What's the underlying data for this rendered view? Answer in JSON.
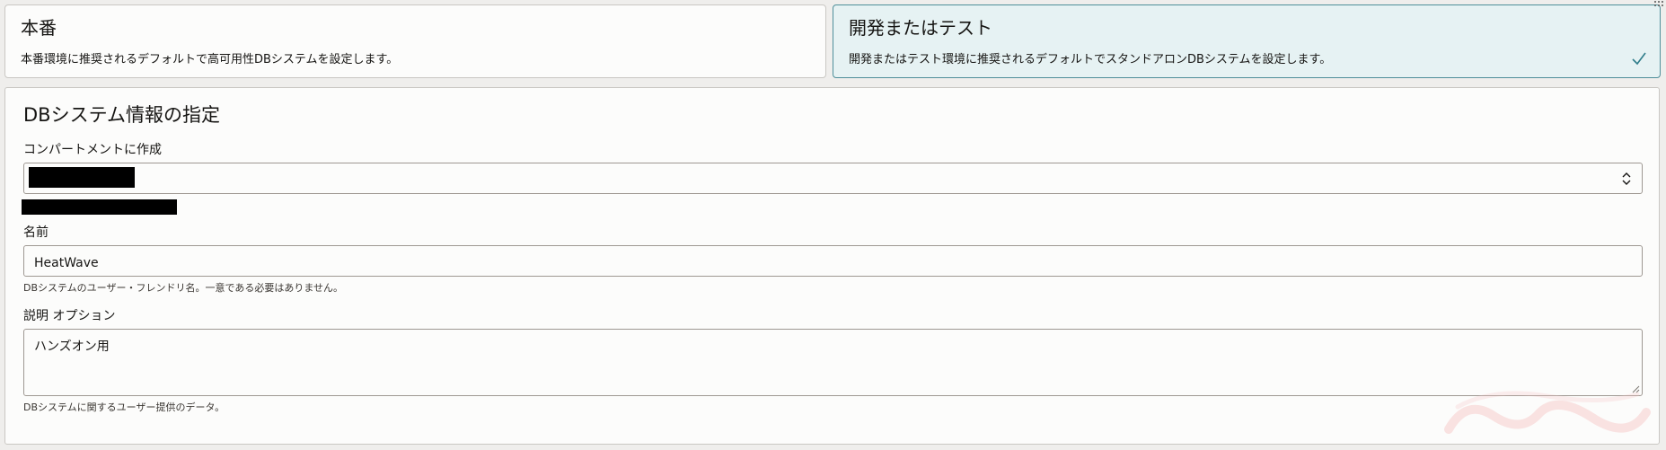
{
  "options": {
    "production": {
      "title": "本番",
      "description": "本番環境に推奨されるデフォルトで高可用性DBシステムを設定します。",
      "selected": false
    },
    "development": {
      "title": "開発またはテスト",
      "description": "開発またはテスト環境に推奨されるデフォルトでスタンドアロンDBシステムを設定します。",
      "selected": true
    }
  },
  "db_info": {
    "section_title": "DBシステム情報の指定",
    "compartment": {
      "label": "コンパートメントに作成",
      "value": "",
      "value_redacted": true,
      "path_redacted": true
    },
    "name": {
      "label": "名前",
      "value": "HeatWave",
      "help": "DBシステムのユーザー・フレンドリ名。一意である必要はありません。"
    },
    "description": {
      "label": "説明  オプション",
      "value": "ハンズオン用",
      "help": "DBシステムに関するユーザー提供のデータ。"
    }
  },
  "colors": {
    "selected_bg": "#e6f2f3",
    "selected_border": "#4f8f9a",
    "checkmark": "#2f7d8a",
    "page_bg": "#efeeec"
  },
  "icons": {
    "selected_check": "checkmark-icon",
    "select_toggle": "chevron-updown-icon",
    "resize": "resize-grip-icon"
  }
}
